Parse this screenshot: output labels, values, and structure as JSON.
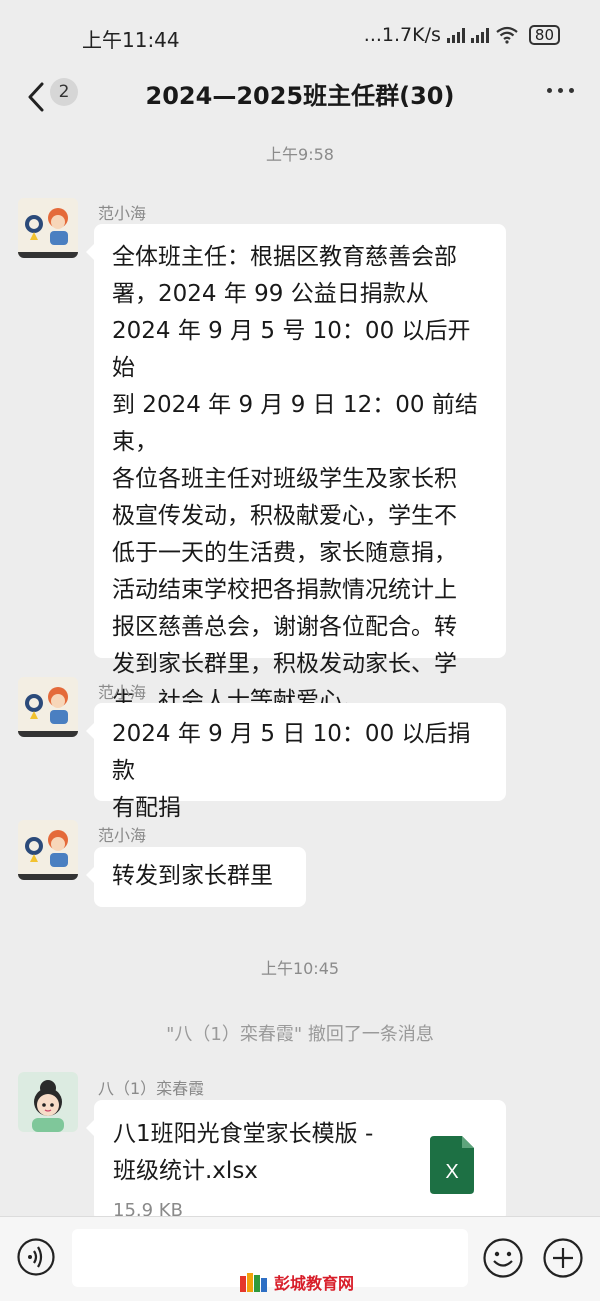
{
  "status_bar": {
    "time": "上午11:44",
    "network": "...1.7K/s",
    "battery": "80"
  },
  "header": {
    "unread_count": "2",
    "title": "2024—2025班主任群(30)"
  },
  "messages": {
    "ts1": "上午9:58",
    "m1": {
      "sender": "范小海",
      "lines": [
        "全体班主任：根据区教育慈善会部",
        "署，2024 年 99 公益日捐款从",
        "2024 年 9 月 5 号 10：00 以后开始",
        "到 2024 年 9 月 9 日 12：00 前结束，",
        "各位各班主任对班级学生及家长积",
        "极宣传发动，积极献爱心，学生不",
        "低于一天的生活费，家长随意捐，",
        "活动结束学校把各捐款情况统计上",
        "报区慈善总会，谢谢各位配合。转",
        "发到家长群里，积极发动家长、学",
        "生、社会人士等献爱心。"
      ]
    },
    "m2": {
      "sender": "范小海",
      "lines": [
        "2024 年 9 月 5 日 10：00 以后捐款",
        "有配捐"
      ]
    },
    "m3": {
      "sender": "范小海",
      "text": "转发到家长群里"
    },
    "ts2": "上午10:45",
    "recall_notice": "\"八（1）栾春霞\" 撤回了一条消息",
    "m4": {
      "sender": "八（1）栾春霞",
      "file_name_line1": "八1班阳光食堂家长模版 -",
      "file_name_line2": "班级统计.xlsx",
      "file_size": "15.9 KB",
      "file_icon_letter": "X"
    }
  },
  "watermark": "彭城教育网",
  "colors": {
    "background": "#ededed",
    "bubble": "#ffffff",
    "excel_green": "#1d7044",
    "watermark_red": "#d81e2a"
  }
}
